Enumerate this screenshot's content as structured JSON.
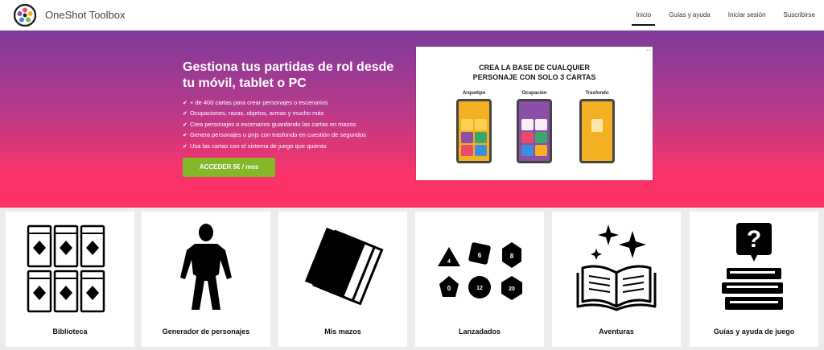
{
  "brand": "OneShot Toolbox",
  "nav": {
    "items": [
      {
        "label": "Inicio",
        "active": true
      },
      {
        "label": "Guías y ayuda",
        "active": false
      },
      {
        "label": "Iniciar sesión",
        "active": false
      },
      {
        "label": "Suscribirse",
        "active": false
      }
    ]
  },
  "hero": {
    "title": "Gestiona tus partidas de rol desde tu móvil, tablet o PC",
    "features": [
      "+ de 400 cartas para crear personajes o escenarios",
      "Ocupaciones, razas, objetos, armas y mucho más",
      "Crea personajes o escenarios guardando las cartas en mazos",
      "Genera personajes o pnjs con trasfondo en cuestión de segundos",
      "Usa las cartas con el sistema de juego que quieras"
    ],
    "cta_label": "ACCEDER 5€ / mes",
    "cta_color": "#84b72a",
    "gradient_top": "#7d3b9c",
    "gradient_bottom": "#ff2f63"
  },
  "promo": {
    "title_line1": "CREA LA BASE DE CUALQUIER",
    "title_line2": "PERSONAJE CON SOLO 3 CARTAS",
    "cards": [
      {
        "label": "Arquetipo",
        "color": "#f4b023"
      },
      {
        "label": "Ocupación",
        "color": "#8b4fa8"
      },
      {
        "label": "Trasfondo",
        "color": "#f4b023"
      }
    ]
  },
  "tools": [
    {
      "label": "Biblioteca",
      "icon": "card-library-icon"
    },
    {
      "label": "Generador de personajes",
      "icon": "character-silhouette-icon"
    },
    {
      "label": "Mis mazos",
      "icon": "card-deck-icon"
    },
    {
      "label": "Lanzadados",
      "icon": "dice-set-icon"
    },
    {
      "label": "Aventuras",
      "icon": "open-book-sparkles-icon"
    },
    {
      "label": "Guías y ayuda de juego",
      "icon": "question-books-icon"
    }
  ]
}
